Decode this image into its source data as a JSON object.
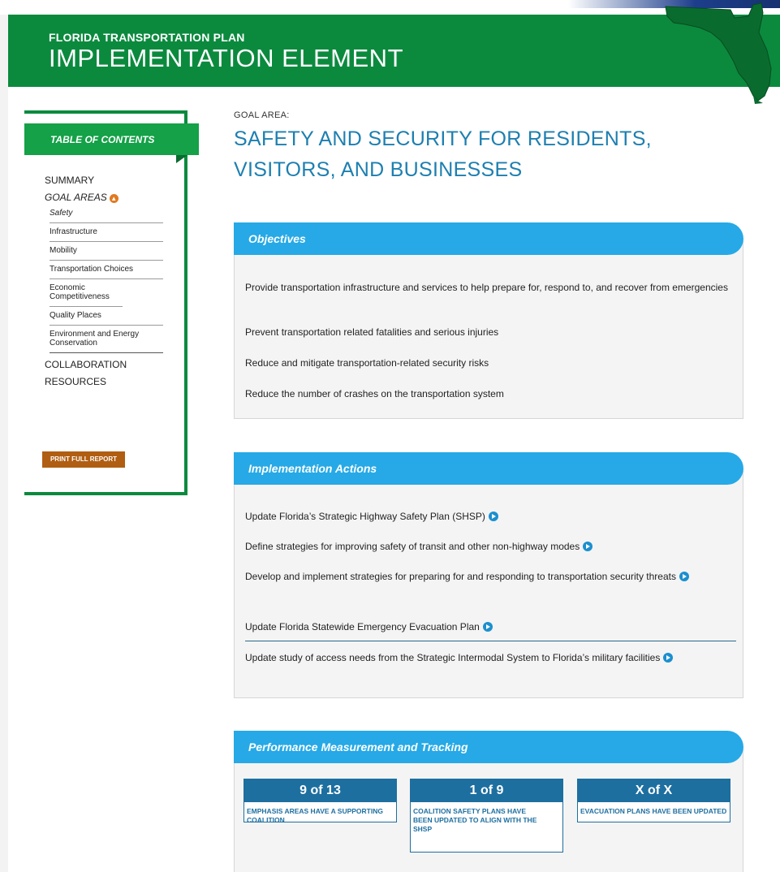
{
  "header": {
    "kicker": "FLORIDA TRANSPORTATION PLAN",
    "title": "IMPLEMENTATION ELEMENT"
  },
  "toc": {
    "heading": "TABLE OF CONTENTS",
    "summary": "SUMMARY",
    "goal_areas": "GOAL AREAS",
    "goal_items": [
      "Safety",
      "Infrastructure",
      "Mobility",
      "Transportation Choices",
      "Economic Competitiveness",
      "Quality Places",
      "Environment and Energy Conservation"
    ],
    "collaboration": "COLLABORATION",
    "resources": "RESOURCES",
    "print_button": "PRINT FULL REPORT"
  },
  "goal": {
    "label": "GOAL AREA:",
    "title": "SAFETY AND SECURITY FOR RESIDENTS, VISITORS, AND BUSINESSES"
  },
  "objectives": {
    "heading": "Objectives",
    "items": [
      "Provide transportation infrastructure and services to help prepare for, respond to, and recover from emergencies",
      "Prevent transportation related fatalities and serious injuries",
      "Reduce and mitigate transportation-related security risks",
      "Reduce the number of crashes on the transportation system"
    ]
  },
  "actions": {
    "heading": "Implementation Actions",
    "items": [
      "Update Florida’s Strategic Highway Safety Plan (SHSP)",
      "Define strategies for improving safety of transit and other non-highway modes",
      "Develop and implement strategies for preparing for and responding to transportation security threats",
      "Update Florida Statewide Emergency Evacuation Plan",
      "Update study of access needs from the Strategic Intermodal System to Florida’s military facilities"
    ]
  },
  "performance": {
    "heading": "Performance Measurement and Tracking",
    "metrics": [
      {
        "value": "9 of 13",
        "label": "EMPHASIS AREAS HAVE A SUPPORTING COALITION"
      },
      {
        "value": "1 of 9",
        "label": "COALITION SAFETY PLANS HAVE BEEN UPDATED TO ALIGN WITH THE SHSP"
      },
      {
        "value": "X of X",
        "label": "EVACUATION PLANS HAVE BEEN UPDATED"
      }
    ]
  },
  "colors": {
    "banner_green": "#0b8a3e",
    "toc_tab_green": "#14a147",
    "section_blue": "#26a9e6",
    "title_blue": "#1d7fb0",
    "metric_blue": "#1d6fa0",
    "print_orange": "#b05e12"
  }
}
